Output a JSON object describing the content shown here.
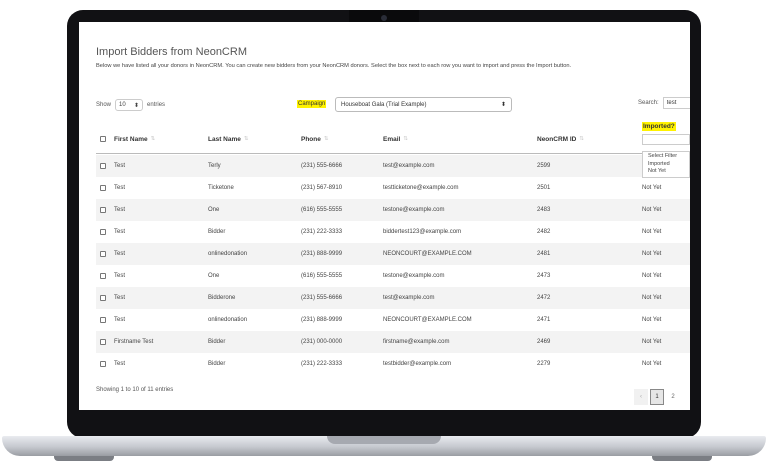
{
  "page": {
    "title": "Import Bidders from NeonCRM",
    "description": "Below we have listed all your donors in NeonCRM. You can create new bidders from your NeonCRM donors. Select the box next to each row you want to import and press the Import button."
  },
  "controls": {
    "show_label": "Show",
    "entries_value": "10",
    "entries_label": "entries",
    "campaign_label": "Campaign",
    "campaign_value": "Houseboat Gala (Trial Example)",
    "search_label": "Search:",
    "search_value": "test"
  },
  "columns": {
    "first_name": "First Name",
    "last_name": "Last Name",
    "phone": "Phone",
    "email": "Email",
    "neon_id": "NeonCRM ID",
    "imported": "Imported?"
  },
  "filter_options": [
    "Select Filter",
    "Imported",
    "Not Yet"
  ],
  "rows": [
    {
      "first": "Test",
      "last": "Terly",
      "phone": "(231) 555-6666",
      "email": "test@example.com",
      "id": "2599",
      "imported": ""
    },
    {
      "first": "Test",
      "last": "Ticketone",
      "phone": "(231) 567-8910",
      "email": "testticketone@example.com",
      "id": "2501",
      "imported": "Not Yet"
    },
    {
      "first": "Test",
      "last": "One",
      "phone": "(616) 555-5555",
      "email": "testone@example.com",
      "id": "2483",
      "imported": "Not Yet"
    },
    {
      "first": "Test",
      "last": "Bidder",
      "phone": "(231) 222-3333",
      "email": "biddertest123@example.com",
      "id": "2482",
      "imported": "Not Yet"
    },
    {
      "first": "Test",
      "last": "onlinedonation",
      "phone": "(231) 888-9999",
      "email": "NEONCOURT@EXAMPLE.COM",
      "id": "2481",
      "imported": "Not Yet"
    },
    {
      "first": "Test",
      "last": "One",
      "phone": "(616) 555-5555",
      "email": "testone@example.com",
      "id": "2473",
      "imported": "Not Yet"
    },
    {
      "first": "Test",
      "last": "Bidderone",
      "phone": "(231) 555-6666",
      "email": "test@example.com",
      "id": "2472",
      "imported": "Not Yet"
    },
    {
      "first": "Test",
      "last": "onlinedonation",
      "phone": "(231) 888-9999",
      "email": "NEONCOURT@EXAMPLE.COM",
      "id": "2471",
      "imported": "Not Yet"
    },
    {
      "first": "Firstname Test",
      "last": "Bidder",
      "phone": "(231) 000-0000",
      "email": "firstname@example.com",
      "id": "2469",
      "imported": "Not Yet"
    },
    {
      "first": "Test",
      "last": "Bidder",
      "phone": "(231) 222-3333",
      "email": "testbidder@example.com",
      "id": "2279",
      "imported": "Not Yet"
    }
  ],
  "footer": {
    "info": "Showing 1 to 10 of 11 entries",
    "prev": "‹",
    "pages": [
      "1",
      "2"
    ],
    "current_page": "1"
  },
  "colors": {
    "highlight": "#fff200",
    "stripe": "#f3f3f3",
    "bezel": "#111114"
  },
  "icons": {
    "select_arrows": "updown-arrows-icon",
    "sort": "sort-icon"
  }
}
